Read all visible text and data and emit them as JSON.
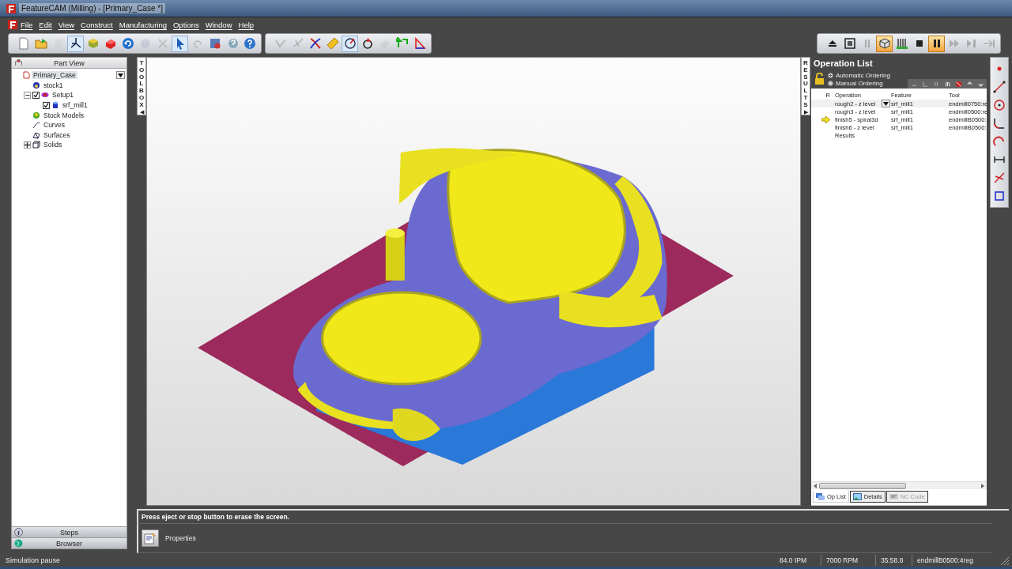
{
  "window": {
    "title": "FeatureCAM (Milling) - [Primary_Case *]"
  },
  "menu": [
    "File",
    "Edit",
    "View",
    "Construct",
    "Manufacturing",
    "Options",
    "Window",
    "Help"
  ],
  "main_toolbar": [
    {
      "selected": false,
      "disabled": false
    },
    {
      "selected": false,
      "disabled": false
    },
    {
      "selected": false,
      "disabled": true
    },
    {
      "selected": true,
      "disabled": false
    },
    {
      "selected": false,
      "disabled": false
    },
    {
      "selected": false,
      "disabled": false
    },
    {
      "selected": false,
      "disabled": false
    },
    {
      "selected": false,
      "disabled": true
    },
    {
      "selected": false,
      "disabled": true
    },
    {
      "selected": true,
      "disabled": false
    },
    {
      "selected": false,
      "disabled": true
    },
    {
      "selected": false,
      "disabled": false
    },
    {
      "selected": false,
      "disabled": false
    },
    {
      "selected": false,
      "disabled": false
    }
  ],
  "draw_toolbar": [
    {
      "selected": false,
      "disabled": true
    },
    {
      "selected": false,
      "disabled": true
    },
    {
      "selected": false,
      "disabled": false
    },
    {
      "selected": false,
      "disabled": false
    },
    {
      "selected": true,
      "disabled": false
    },
    {
      "selected": false,
      "disabled": false
    },
    {
      "selected": false,
      "disabled": true
    },
    {
      "selected": false,
      "disabled": false
    },
    {
      "selected": false,
      "disabled": false
    }
  ],
  "sim_toolbar": [
    {
      "selected": false,
      "disabled": false
    },
    {
      "selected": false,
      "disabled": false
    },
    {
      "selected": false,
      "disabled": true
    },
    {
      "selected": true,
      "disabled": false
    },
    {
      "selected": false,
      "disabled": false
    },
    {
      "selected": false,
      "disabled": false
    },
    {
      "selected": true,
      "disabled": false
    },
    {
      "selected": false,
      "disabled": true
    },
    {
      "selected": false,
      "disabled": true
    },
    {
      "selected": false,
      "disabled": true
    }
  ],
  "part_view": {
    "title": "Part View",
    "tree": [
      {
        "label": "Primary_Case",
        "selected": true,
        "children": [
          {
            "label": "stock1",
            "selected": false
          },
          {
            "label": "Setup1",
            "selected": false,
            "expanded": true,
            "checked": true,
            "children": [
              {
                "label": "srf_mill1",
                "selected": false,
                "checked": true
              }
            ]
          },
          {
            "label": "Stock Models",
            "selected": false
          },
          {
            "label": "Curves",
            "selected": false
          },
          {
            "label": "Surfaces",
            "selected": false
          },
          {
            "label": "Solids",
            "selected": false,
            "expanded": false
          }
        ]
      }
    ],
    "bottom_tabs": [
      "Steps",
      "Browser"
    ]
  },
  "toolbox_tab": {
    "label": "TOOLBOX",
    "arrow": "◀"
  },
  "results_tab": {
    "label": "RESULTS",
    "arrow": "▶"
  },
  "operation_list": {
    "title": "Operation List",
    "ordering": [
      {
        "label": "Automatic Ordering",
        "selected": true
      },
      {
        "label": "Manual Ordering",
        "selected": false
      }
    ],
    "columns": [
      "R",
      "Operation",
      "Feature",
      "Tool"
    ],
    "rows": [
      {
        "kind": "op",
        "operation": "rough2 - z level",
        "feature": "srf_mill1",
        "tool": "endmill0750:re",
        "selected": true,
        "current": false
      },
      {
        "kind": "op",
        "operation": "rough3 - z level",
        "feature": "srf_mill1",
        "tool": "endmill0500:re",
        "selected": false,
        "current": false
      },
      {
        "kind": "op",
        "operation": "finish5 - spiral3d",
        "feature": "srf_mill1",
        "tool": "endmillB0500:",
        "selected": false,
        "current": true
      },
      {
        "kind": "op",
        "operation": "finish6 - z level",
        "feature": "srf_mill1",
        "tool": "endmillB0500:",
        "selected": false,
        "current": false
      },
      {
        "kind": "results",
        "operation": "Results",
        "selected": false,
        "current": false
      }
    ],
    "tabs": [
      {
        "label": "Op List",
        "selected": true,
        "disabled": false
      },
      {
        "label": "Details",
        "selected": false,
        "disabled": false
      },
      {
        "label": "NC Code",
        "selected": false,
        "disabled": true
      }
    ]
  },
  "message": "Press eject or stop button to erase the screen.",
  "properties": {
    "label": "Properties"
  },
  "status_bar": {
    "message": "Simulation pause",
    "fields": [
      "84.0 IPM",
      "7000 RPM",
      "35:58.8",
      "endmillB0500:4reg"
    ]
  }
}
